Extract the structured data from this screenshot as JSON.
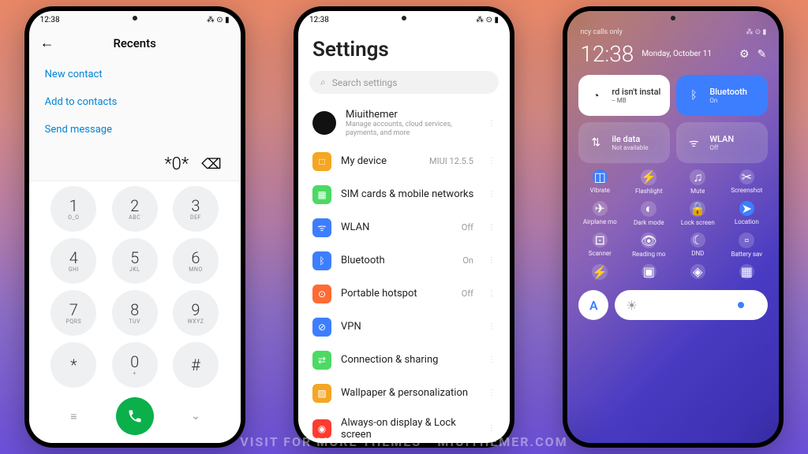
{
  "status": {
    "time": "12:38",
    "icons": "⁂ ⊙ ▮"
  },
  "phone1": {
    "title": "Recents",
    "actions": [
      "New contact",
      "Add to contacts",
      "Send message"
    ],
    "typed": "*0*",
    "keys": [
      [
        "1",
        "O_O"
      ],
      [
        "2",
        "ABC"
      ],
      [
        "3",
        "DEF"
      ],
      [
        "4",
        "GHI"
      ],
      [
        "5",
        "JKL"
      ],
      [
        "6",
        "MNO"
      ],
      [
        "7",
        "PQRS"
      ],
      [
        "8",
        "TUV"
      ],
      [
        "9",
        "WXYZ"
      ],
      [
        "*",
        ""
      ],
      [
        "0",
        "+"
      ],
      [
        "#",
        ""
      ]
    ]
  },
  "phone2": {
    "title": "Settings",
    "searchPlaceholder": "Search settings",
    "profile": {
      "name": "Miuithemer",
      "desc": "Manage accounts, cloud services, payments, and more"
    },
    "items": [
      {
        "icon": "□",
        "color": "#f5a623",
        "label": "My device",
        "value": "MIUI 12.5.5"
      },
      {
        "icon": "▦",
        "color": "#4cd964",
        "label": "SIM cards & mobile networks",
        "value": ""
      },
      {
        "icon": "ᯤ",
        "color": "#3d7eff",
        "label": "WLAN",
        "value": "Off"
      },
      {
        "icon": "ᛒ",
        "color": "#3d7eff",
        "label": "Bluetooth",
        "value": "On"
      },
      {
        "icon": "⊙",
        "color": "#ff6b35",
        "label": "Portable hotspot",
        "value": "Off"
      },
      {
        "icon": "⊘",
        "color": "#3d7eff",
        "label": "VPN",
        "value": ""
      },
      {
        "icon": "⇄",
        "color": "#4cd964",
        "label": "Connection & sharing",
        "value": ""
      },
      {
        "icon": "▨",
        "color": "#f5a623",
        "label": "Wallpaper & personalization",
        "value": ""
      },
      {
        "icon": "◉",
        "color": "#ff3b30",
        "label": "Always-on display & Lock screen",
        "value": ""
      }
    ]
  },
  "phone3": {
    "emergency": "ncy calls only",
    "time": "12:38",
    "date": "Monday, October 11",
    "largeTiles": [
      {
        "type": "white",
        "icon": "◔",
        "label": "rd isn't instal",
        "status": "-- MB"
      },
      {
        "type": "blue",
        "icon": "ᛒ",
        "label": "Bluetooth",
        "status": "On"
      },
      {
        "type": "glass",
        "icon": "⇅",
        "label": "ile data",
        "status": "Not available"
      },
      {
        "type": "glass",
        "icon": "ᯤ",
        "label": "WLAN",
        "status": "Off"
      }
    ],
    "smallTiles": [
      {
        "icon": "◫",
        "label": "Vibrate",
        "active": true
      },
      {
        "icon": "⚡",
        "label": "Flashlight",
        "active": false
      },
      {
        "icon": "♫",
        "label": "Mute",
        "active": false
      },
      {
        "icon": "✂",
        "label": "Screenshot",
        "active": false
      },
      {
        "icon": "✈",
        "label": "Airplane mo",
        "active": false
      },
      {
        "icon": "◐",
        "label": "Dark mode",
        "active": false
      },
      {
        "icon": "🔒",
        "label": "Lock screen",
        "active": false
      },
      {
        "icon": "➤",
        "label": "Location",
        "active": true
      },
      {
        "icon": "⊡",
        "label": "Scanner",
        "active": false
      },
      {
        "icon": "👁",
        "label": "Reading mo",
        "active": false
      },
      {
        "icon": "☾",
        "label": "DND",
        "active": false
      },
      {
        "icon": "▫",
        "label": "Battery sav",
        "active": false
      },
      {
        "icon": "⚡",
        "label": "",
        "active": false
      },
      {
        "icon": "▣",
        "label": "",
        "active": false
      },
      {
        "icon": "◈",
        "label": "",
        "active": false
      },
      {
        "icon": "▦",
        "label": "",
        "active": false
      }
    ],
    "letter": "A"
  },
  "watermark": "VISIT FOR MORE THEMES - MIUITHEMER.COM"
}
